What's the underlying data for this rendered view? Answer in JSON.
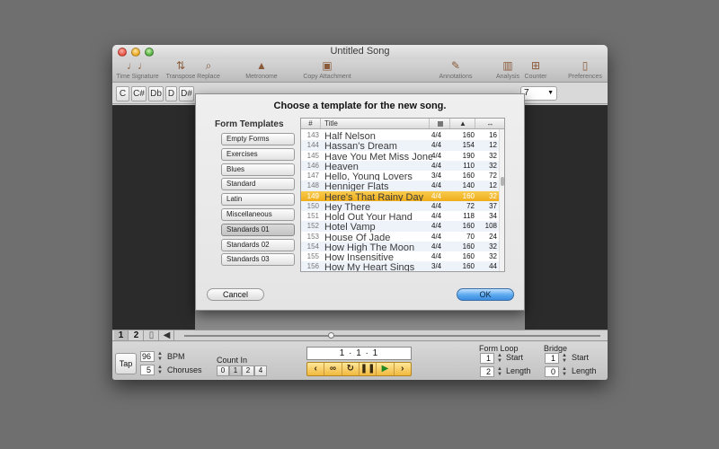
{
  "window": {
    "title": "Untitled Song"
  },
  "toolbar": {
    "items": [
      {
        "label": "Time Signature",
        "icon": "time-signature-icon",
        "glyph": "♩♩"
      },
      {
        "label": "Transpose",
        "icon": "transpose-icon",
        "glyph": "⇅"
      },
      {
        "label": "Replace",
        "icon": "replace-icon",
        "glyph": "⌕"
      },
      {
        "label": "Metronome",
        "icon": "metronome-icon",
        "glyph": "▲"
      },
      {
        "label": "Copy Attachment",
        "icon": "copy-attachment-icon",
        "glyph": "▣"
      },
      {
        "label": "Annotations",
        "icon": "annotations-icon",
        "glyph": "✎"
      },
      {
        "label": "Analysis",
        "icon": "analysis-icon",
        "glyph": "▥"
      },
      {
        "label": "Counter",
        "icon": "counter-icon",
        "glyph": "⊞"
      },
      {
        "label": "Preferences",
        "icon": "preferences-icon",
        "glyph": "▯"
      }
    ]
  },
  "keys": [
    "C",
    "C#",
    "Db",
    "D",
    "D#"
  ],
  "key_select_value": "7",
  "dialog": {
    "title": "Choose a template for the new song.",
    "form_templates_heading": "Form Templates",
    "form_templates": [
      {
        "label": "Empty Forms",
        "selected": false
      },
      {
        "label": "Exercises",
        "selected": false
      },
      {
        "label": "Blues",
        "selected": false
      },
      {
        "label": "Standard",
        "selected": false
      },
      {
        "label": "Latin",
        "selected": false
      },
      {
        "label": "Miscellaneous",
        "selected": false
      },
      {
        "label": "Standards 01",
        "selected": true
      },
      {
        "label": "Standards 02",
        "selected": false
      },
      {
        "label": "Standards 03",
        "selected": false
      }
    ],
    "columns": {
      "number": "#",
      "title": "Title"
    },
    "songs": [
      {
        "num": "143",
        "title": "Half Nelson",
        "sig": "4/4",
        "tempo": "160",
        "bars": "16"
      },
      {
        "num": "144",
        "title": "Hassan's Dream",
        "sig": "4/4",
        "tempo": "154",
        "bars": "12"
      },
      {
        "num": "145",
        "title": "Have You Met Miss Jones",
        "sig": "4/4",
        "tempo": "190",
        "bars": "32"
      },
      {
        "num": "146",
        "title": "Heaven",
        "sig": "4/4",
        "tempo": "110",
        "bars": "32"
      },
      {
        "num": "147",
        "title": "Hello, Young Lovers",
        "sig": "3/4",
        "tempo": "160",
        "bars": "72"
      },
      {
        "num": "148",
        "title": "Henniger Flats",
        "sig": "4/4",
        "tempo": "140",
        "bars": "12"
      },
      {
        "num": "149",
        "title": "Here's That Rainy Day",
        "sig": "4/4",
        "tempo": "160",
        "bars": "32"
      },
      {
        "num": "150",
        "title": "Hey There",
        "sig": "4/4",
        "tempo": "72",
        "bars": "37"
      },
      {
        "num": "151",
        "title": "Hold Out Your Hand",
        "sig": "4/4",
        "tempo": "118",
        "bars": "34"
      },
      {
        "num": "152",
        "title": "Hotel Vamp",
        "sig": "4/4",
        "tempo": "160",
        "bars": "108"
      },
      {
        "num": "153",
        "title": "House Of Jade",
        "sig": "4/4",
        "tempo": "70",
        "bars": "24"
      },
      {
        "num": "154",
        "title": "How High The Moon",
        "sig": "4/4",
        "tempo": "160",
        "bars": "32"
      },
      {
        "num": "155",
        "title": "How Insensitive",
        "sig": "4/4",
        "tempo": "160",
        "bars": "32"
      },
      {
        "num": "156",
        "title": "How My Heart Sings",
        "sig": "3/4",
        "tempo": "160",
        "bars": "44"
      }
    ],
    "selected_index": 6,
    "cancel_label": "Cancel",
    "ok_label": "OK"
  },
  "tabs": [
    "1",
    "2"
  ],
  "bottom": {
    "tap_label": "Tap",
    "bpm_value": "96",
    "bpm_label": "BPM",
    "choruses_value": "5",
    "choruses_label": "Choruses",
    "count_in_label": "Count In",
    "count_in_options": [
      "0",
      "1",
      "2",
      "4"
    ],
    "count_in_selected": "1",
    "position_display": "1 · 1 · 1",
    "form_loop_label": "Form Loop",
    "form_loop_start": "1",
    "form_loop_length": "2",
    "bridge_label": "Bridge",
    "bridge_start": "1",
    "bridge_length": "0",
    "start_label": "Start",
    "length_label": "Length"
  }
}
